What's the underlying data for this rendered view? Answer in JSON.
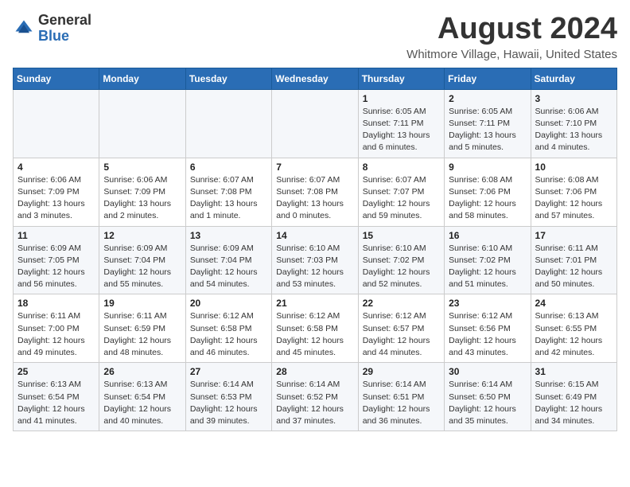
{
  "header": {
    "logo_general": "General",
    "logo_blue": "Blue",
    "month_title": "August 2024",
    "location": "Whitmore Village, Hawaii, United States"
  },
  "weekdays": [
    "Sunday",
    "Monday",
    "Tuesday",
    "Wednesday",
    "Thursday",
    "Friday",
    "Saturday"
  ],
  "weeks": [
    [
      {
        "day": "",
        "info": ""
      },
      {
        "day": "",
        "info": ""
      },
      {
        "day": "",
        "info": ""
      },
      {
        "day": "",
        "info": ""
      },
      {
        "day": "1",
        "info": "Sunrise: 6:05 AM\nSunset: 7:11 PM\nDaylight: 13 hours and 6 minutes."
      },
      {
        "day": "2",
        "info": "Sunrise: 6:05 AM\nSunset: 7:11 PM\nDaylight: 13 hours and 5 minutes."
      },
      {
        "day": "3",
        "info": "Sunrise: 6:06 AM\nSunset: 7:10 PM\nDaylight: 13 hours and 4 minutes."
      }
    ],
    [
      {
        "day": "4",
        "info": "Sunrise: 6:06 AM\nSunset: 7:09 PM\nDaylight: 13 hours and 3 minutes."
      },
      {
        "day": "5",
        "info": "Sunrise: 6:06 AM\nSunset: 7:09 PM\nDaylight: 13 hours and 2 minutes."
      },
      {
        "day": "6",
        "info": "Sunrise: 6:07 AM\nSunset: 7:08 PM\nDaylight: 13 hours and 1 minute."
      },
      {
        "day": "7",
        "info": "Sunrise: 6:07 AM\nSunset: 7:08 PM\nDaylight: 13 hours and 0 minutes."
      },
      {
        "day": "8",
        "info": "Sunrise: 6:07 AM\nSunset: 7:07 PM\nDaylight: 12 hours and 59 minutes."
      },
      {
        "day": "9",
        "info": "Sunrise: 6:08 AM\nSunset: 7:06 PM\nDaylight: 12 hours and 58 minutes."
      },
      {
        "day": "10",
        "info": "Sunrise: 6:08 AM\nSunset: 7:06 PM\nDaylight: 12 hours and 57 minutes."
      }
    ],
    [
      {
        "day": "11",
        "info": "Sunrise: 6:09 AM\nSunset: 7:05 PM\nDaylight: 12 hours and 56 minutes."
      },
      {
        "day": "12",
        "info": "Sunrise: 6:09 AM\nSunset: 7:04 PM\nDaylight: 12 hours and 55 minutes."
      },
      {
        "day": "13",
        "info": "Sunrise: 6:09 AM\nSunset: 7:04 PM\nDaylight: 12 hours and 54 minutes."
      },
      {
        "day": "14",
        "info": "Sunrise: 6:10 AM\nSunset: 7:03 PM\nDaylight: 12 hours and 53 minutes."
      },
      {
        "day": "15",
        "info": "Sunrise: 6:10 AM\nSunset: 7:02 PM\nDaylight: 12 hours and 52 minutes."
      },
      {
        "day": "16",
        "info": "Sunrise: 6:10 AM\nSunset: 7:02 PM\nDaylight: 12 hours and 51 minutes."
      },
      {
        "day": "17",
        "info": "Sunrise: 6:11 AM\nSunset: 7:01 PM\nDaylight: 12 hours and 50 minutes."
      }
    ],
    [
      {
        "day": "18",
        "info": "Sunrise: 6:11 AM\nSunset: 7:00 PM\nDaylight: 12 hours and 49 minutes."
      },
      {
        "day": "19",
        "info": "Sunrise: 6:11 AM\nSunset: 6:59 PM\nDaylight: 12 hours and 48 minutes."
      },
      {
        "day": "20",
        "info": "Sunrise: 6:12 AM\nSunset: 6:58 PM\nDaylight: 12 hours and 46 minutes."
      },
      {
        "day": "21",
        "info": "Sunrise: 6:12 AM\nSunset: 6:58 PM\nDaylight: 12 hours and 45 minutes."
      },
      {
        "day": "22",
        "info": "Sunrise: 6:12 AM\nSunset: 6:57 PM\nDaylight: 12 hours and 44 minutes."
      },
      {
        "day": "23",
        "info": "Sunrise: 6:12 AM\nSunset: 6:56 PM\nDaylight: 12 hours and 43 minutes."
      },
      {
        "day": "24",
        "info": "Sunrise: 6:13 AM\nSunset: 6:55 PM\nDaylight: 12 hours and 42 minutes."
      }
    ],
    [
      {
        "day": "25",
        "info": "Sunrise: 6:13 AM\nSunset: 6:54 PM\nDaylight: 12 hours and 41 minutes."
      },
      {
        "day": "26",
        "info": "Sunrise: 6:13 AM\nSunset: 6:54 PM\nDaylight: 12 hours and 40 minutes."
      },
      {
        "day": "27",
        "info": "Sunrise: 6:14 AM\nSunset: 6:53 PM\nDaylight: 12 hours and 39 minutes."
      },
      {
        "day": "28",
        "info": "Sunrise: 6:14 AM\nSunset: 6:52 PM\nDaylight: 12 hours and 37 minutes."
      },
      {
        "day": "29",
        "info": "Sunrise: 6:14 AM\nSunset: 6:51 PM\nDaylight: 12 hours and 36 minutes."
      },
      {
        "day": "30",
        "info": "Sunrise: 6:14 AM\nSunset: 6:50 PM\nDaylight: 12 hours and 35 minutes."
      },
      {
        "day": "31",
        "info": "Sunrise: 6:15 AM\nSunset: 6:49 PM\nDaylight: 12 hours and 34 minutes."
      }
    ]
  ]
}
